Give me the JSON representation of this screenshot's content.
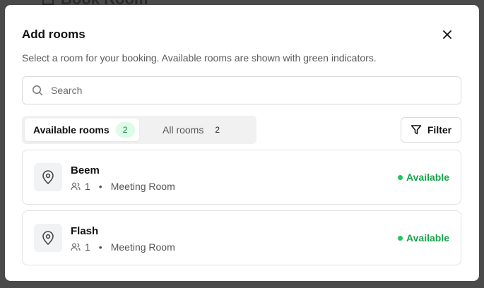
{
  "background": {
    "title": "Book Room"
  },
  "modal": {
    "title": "Add rooms",
    "description": "Select a room for your booking. Available rooms are shown with green indicators.",
    "search_placeholder": "Search",
    "tabs": [
      {
        "label": "Available rooms",
        "count": "2"
      },
      {
        "label": "All rooms",
        "count": "2"
      }
    ],
    "filter_label": "Filter",
    "rooms": [
      {
        "name": "Beem",
        "capacity": "1",
        "separator": "•",
        "type": "Meeting Room",
        "status": "Available"
      },
      {
        "name": "Flash",
        "capacity": "1",
        "separator": "•",
        "type": "Meeting Room",
        "status": "Available"
      }
    ]
  },
  "colors": {
    "available": "#16a34a",
    "badge_bg": "#dcfce7",
    "overlay": "#4a4a4a"
  },
  "icons": [
    "close-icon",
    "search-icon",
    "filter-icon",
    "map-pin-icon",
    "users-icon",
    "calendar-icon"
  ]
}
